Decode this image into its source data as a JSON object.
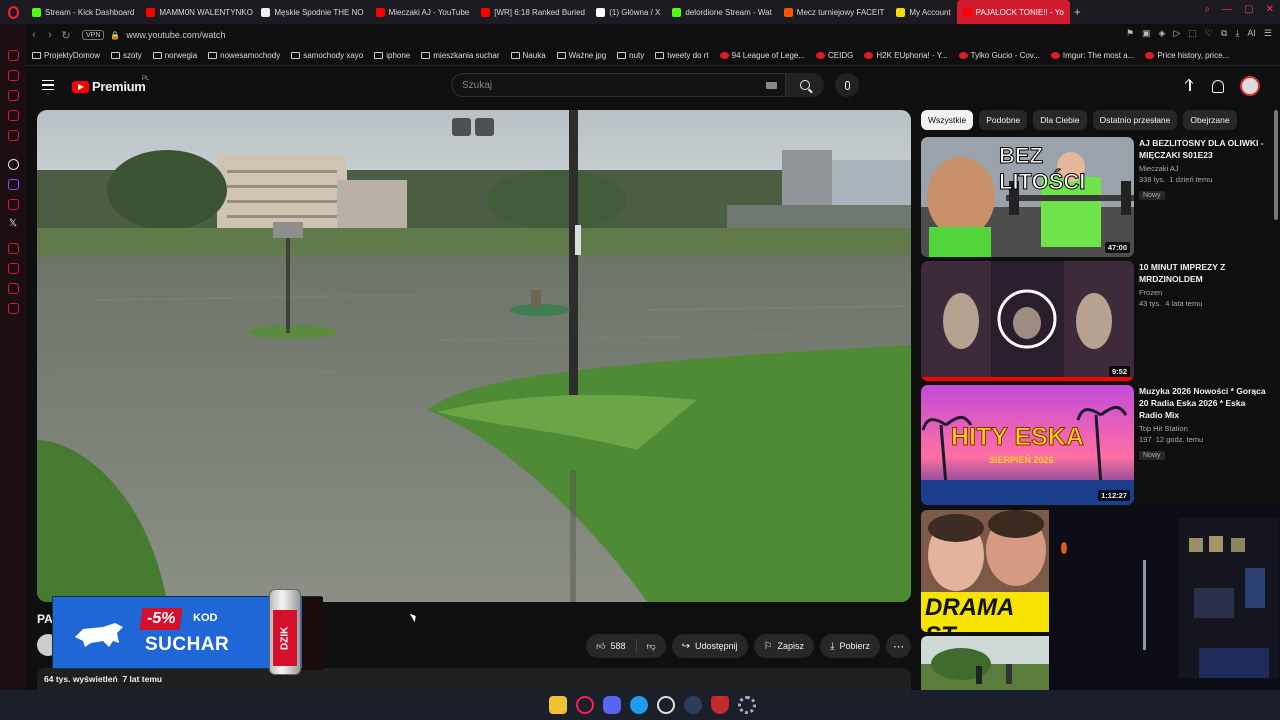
{
  "browser": {
    "tabs": [
      {
        "label": "Stream - Kick Dashboard",
        "color": "#53fc18"
      },
      {
        "label": "MAMM0N WALENTYNKO",
        "color": "#ff0000"
      },
      {
        "label": "Męskie Spodnie THE NO",
        "color": "#eeeeee"
      },
      {
        "label": "Mieczaki AJ - YouTube",
        "color": "#ff0000"
      },
      {
        "label": "[WR] 6:18 Ranked Buried",
        "color": "#ff0000"
      },
      {
        "label": "(1) Główna / X",
        "color": "#ffffff"
      },
      {
        "label": "delordione Stream - Wat",
        "color": "#53fc18"
      },
      {
        "label": "Mecz turniejowy FACEIT",
        "color": "#ff5500"
      },
      {
        "label": "My Account",
        "color": "#f5d90a"
      },
      {
        "label": "PAJALOCK TONIE!! - Yo",
        "color": "#ff0000",
        "active": true
      }
    ],
    "url": "www.youtube.com/watch",
    "vpn_label": "VPN",
    "bookmarks": [
      "ProjektyDomow",
      "szoty",
      "norwegia",
      "nowesamochody",
      "samochody xayo",
      "iphone",
      "mieszkania suchar",
      "Nauka",
      "Ważne jpg",
      "nuty",
      "tweety do rt",
      "94 League of Lege...",
      "CEIDG",
      "H2K EUphoria! - Y...",
      "Tylko Gucio - Cov...",
      "Imgur: The most a...",
      "Price history, price..."
    ],
    "extension_label": "AI"
  },
  "youtube": {
    "logo": "Premium",
    "region": "PL",
    "search_placeholder": "Szukaj",
    "video": {
      "title_visible": "PA",
      "likes": "588",
      "share": "Udostępnij",
      "save": "Zapisz",
      "download": "Pobierz",
      "views": "64 tys. wyświetleń",
      "age": "7 lat temu"
    },
    "ad": {
      "discount": "-5%",
      "kod": "KOD",
      "code": "SUCHAR",
      "can_brand": "DZIK"
    },
    "chips": [
      "Wszystkie",
      "Podobne",
      "Dla Ciebie",
      "Ostatnio przesłane",
      "Obejrzane"
    ],
    "recommendations": [
      {
        "title": "AJ BEZLITOSNY DLA OLIWKI - MIĘCZAKI S01E23",
        "channel": "Mieczaki AJ",
        "views": "338 tys.",
        "age": "1 dzień temu",
        "badge": "Nowy",
        "duration": "47:00",
        "thumb_text": "BEZ LITOŚCI"
      },
      {
        "title": "10 MINUT IMPREZY Z MRDZINOLDEM",
        "channel": "Frozen",
        "views": "43 tys.",
        "age": "4 lata temu",
        "duration": "9:52"
      },
      {
        "title": "Muzyka 2026 Nowości * Gorąca 20 Radia Eska 2026 * Eska Radio Mix",
        "channel": "Top Hit Station",
        "views": "197",
        "age": "12 godz. temu",
        "badge": "Nowy",
        "duration": "1:12:27",
        "thumb_text": "HITY ESKA",
        "thumb_sub": "SIERPIEŃ 2026"
      },
      {
        "thumb_text": "DRAMA ST"
      }
    ]
  }
}
